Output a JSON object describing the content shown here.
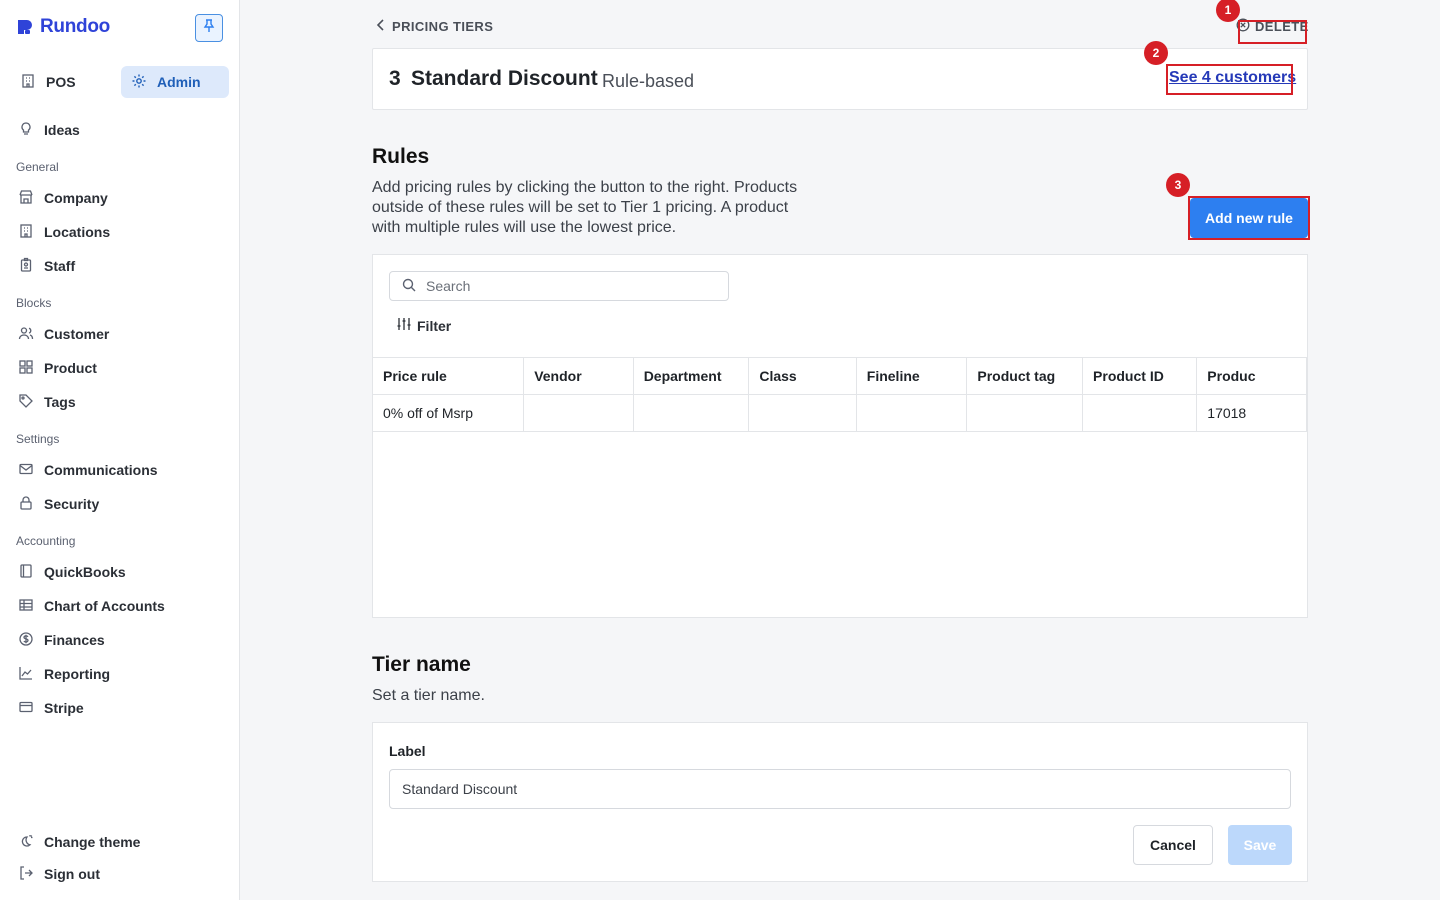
{
  "app": {
    "brand": "Rundoo",
    "brand_color": "#2f43d8"
  },
  "sidebar": {
    "modes": [
      {
        "label": "POS",
        "icon": "building-icon"
      },
      {
        "label": "Admin",
        "icon": "gear-icon",
        "active": true
      }
    ],
    "items": [
      {
        "label": "Ideas",
        "icon": "lightbulb-icon"
      },
      {
        "section": "General"
      },
      {
        "label": "Company",
        "icon": "store-icon"
      },
      {
        "label": "Locations",
        "icon": "building-icon"
      },
      {
        "label": "Staff",
        "icon": "badge-icon"
      },
      {
        "section": "Blocks"
      },
      {
        "label": "Customer",
        "icon": "users-icon"
      },
      {
        "label": "Product",
        "icon": "grid-icon"
      },
      {
        "label": "Tags",
        "icon": "tag-icon"
      },
      {
        "section": "Settings"
      },
      {
        "label": "Communications",
        "icon": "mail-icon"
      },
      {
        "label": "Security",
        "icon": "lock-icon"
      },
      {
        "section": "Accounting"
      },
      {
        "label": "QuickBooks",
        "icon": "book-icon"
      },
      {
        "label": "Chart of Accounts",
        "icon": "table-icon"
      },
      {
        "label": "Finances",
        "icon": "dollar-icon"
      },
      {
        "label": "Reporting",
        "icon": "chart-icon"
      },
      {
        "label": "Stripe",
        "icon": "card-icon"
      }
    ],
    "footer": [
      {
        "label": "Change theme",
        "icon": "theme-icon"
      },
      {
        "label": "Sign out",
        "icon": "sign-out-icon"
      }
    ]
  },
  "header": {
    "back_label": "PRICING TIERS",
    "delete_label": "DELETE",
    "tier_number": "3",
    "tier_title": "Standard Discount",
    "tier_type": "Rule-based",
    "customers_link": "See 4 customers"
  },
  "rules": {
    "heading": "Rules",
    "description_lines": [
      "Add pricing rules by clicking the button to the right. Products",
      "outside of these rules will be set to Tier 1 pricing. A product",
      "with multiple rules will use the lowest price."
    ],
    "add_button": "Add new rule",
    "search_placeholder": "Search",
    "filter_label": "Filter",
    "columns": [
      "Price rule",
      "Vendor",
      "Department",
      "Class",
      "Fineline",
      "Product tag",
      "Product ID",
      "Produc"
    ],
    "rows": [
      [
        "0% off of Msrp",
        "",
        "",
        "",
        "",
        "",
        "",
        "17018"
      ]
    ]
  },
  "tier_name": {
    "heading": "Tier name",
    "description": "Set a tier name.",
    "label": "Label",
    "value": "Standard Discount",
    "cancel": "Cancel",
    "save": "Save"
  },
  "annotations": [
    "1",
    "2",
    "3"
  ],
  "colors": {
    "accent": "#2d7ff0",
    "annotation": "#d61f26",
    "link": "#2539b8"
  }
}
